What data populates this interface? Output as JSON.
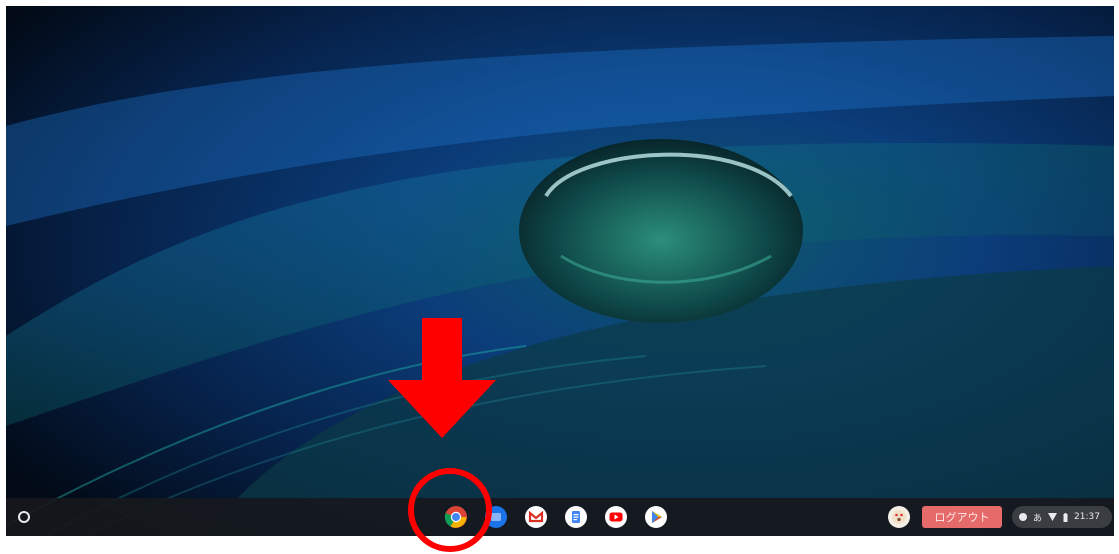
{
  "shelf": {
    "launcher_icon": "launcher-icon",
    "apps": [
      {
        "name": "chrome-icon"
      },
      {
        "name": "files-icon"
      },
      {
        "name": "gmail-icon"
      },
      {
        "name": "docs-icon"
      },
      {
        "name": "youtube-icon"
      },
      {
        "name": "play-store-icon"
      }
    ],
    "logout_label": "ログアウト",
    "tray": {
      "ime_label": "あ",
      "time": "21:37"
    }
  },
  "colors": {
    "shelf": "#16181c",
    "logout": "#e56a6a",
    "annotation": "#ff0000"
  }
}
